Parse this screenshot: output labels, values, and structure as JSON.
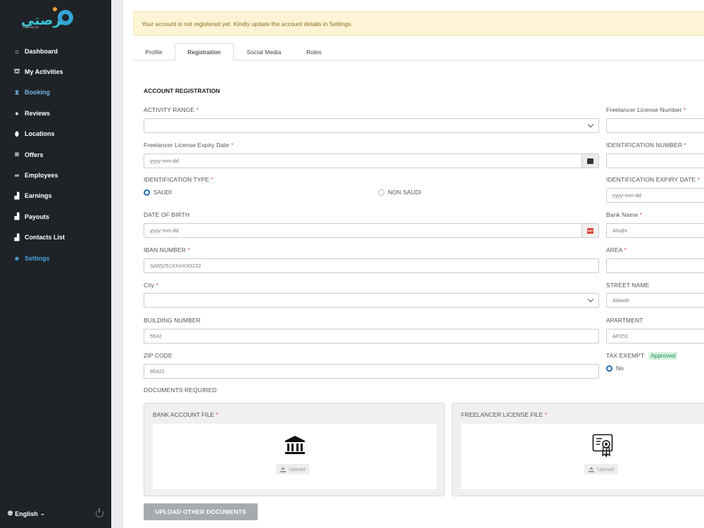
{
  "app": {
    "logo_text": "فرصتي",
    "logo_sub": "Forsaty.sa"
  },
  "sidebar": {
    "items": [
      {
        "label": "Dashboard",
        "icon": "home-icon"
      },
      {
        "label": "My Activities",
        "icon": "activities-icon"
      },
      {
        "label": "Booking",
        "icon": "booking-icon"
      },
      {
        "label": "Reviews",
        "icon": "chat-icon"
      },
      {
        "label": "Locations",
        "icon": "map-pin-icon"
      },
      {
        "label": "Offers",
        "icon": "layers-icon"
      },
      {
        "label": "Employees",
        "icon": "users-icon"
      },
      {
        "label": "Earnings",
        "icon": "chart-icon"
      },
      {
        "label": "Payouts",
        "icon": "chart-icon"
      },
      {
        "label": "Contacts List",
        "icon": "chart-icon"
      },
      {
        "label": "Settings",
        "icon": "user-gear-icon"
      }
    ],
    "language": "English"
  },
  "alert": {
    "text": "Your account is not registered yet. Kindly update the account details in Settings."
  },
  "tabs": [
    "Profile",
    "Registraition",
    "Social Media",
    "Roles"
  ],
  "form": {
    "section_title": "ACCOUNT REGISTRATION",
    "activity_range": {
      "label": "ACTIVITY RANGE",
      "value": ""
    },
    "license_expiry": {
      "label": "Freelancer License Expiry Date",
      "placeholder": "yyyy-mm-dd"
    },
    "id_type": {
      "label": "IDENTIFICATION TYPE",
      "options": [
        "SAUDI",
        "NON SAUDI"
      ],
      "selected": "SAUDI"
    },
    "dob": {
      "label": "DATE OF BIRTH",
      "placeholder": "yyyy-mm-dd"
    },
    "iban": {
      "label": "IBAN NUMBER",
      "value": "SA55251XXXXX5222"
    },
    "city": {
      "label": "City",
      "value": ""
    },
    "building": {
      "label": "BUILDING NUMBER",
      "value": "5542"
    },
    "zip": {
      "label": "ZIP CODE",
      "value": "85422"
    },
    "license_number": {
      "label": "Freelancer License Number",
      "value": ""
    },
    "id_number": {
      "label": "IDENTIFICATION NUMBER",
      "value": ""
    },
    "id_expiry": {
      "label": "IDENTIFICATION EXPIRY DATE",
      "placeholder": "yyyy-mm-dd"
    },
    "bank_name": {
      "label": "Bank Name",
      "value": "Alrajhi"
    },
    "area": {
      "label": "AREA",
      "value": ""
    },
    "street": {
      "label": "STREET NAME",
      "value": "Alawali"
    },
    "apartment": {
      "label": "APARTMENT",
      "value": "AP251"
    },
    "tax_exempt": {
      "label": "TAX EXEMPT",
      "badge": "Approved",
      "option": "No"
    },
    "req_mark": "*"
  },
  "documents": {
    "title": "DOCUMENTS REQUIRED",
    "bank_file": {
      "label": "BANK ACCOUNT FILE",
      "upload": "Upload"
    },
    "license_file": {
      "label": "FREELANCER LICENSE FILE",
      "upload": "Upload"
    },
    "upload_other": "UPLOAD OTHER DOCUMENTS"
  }
}
